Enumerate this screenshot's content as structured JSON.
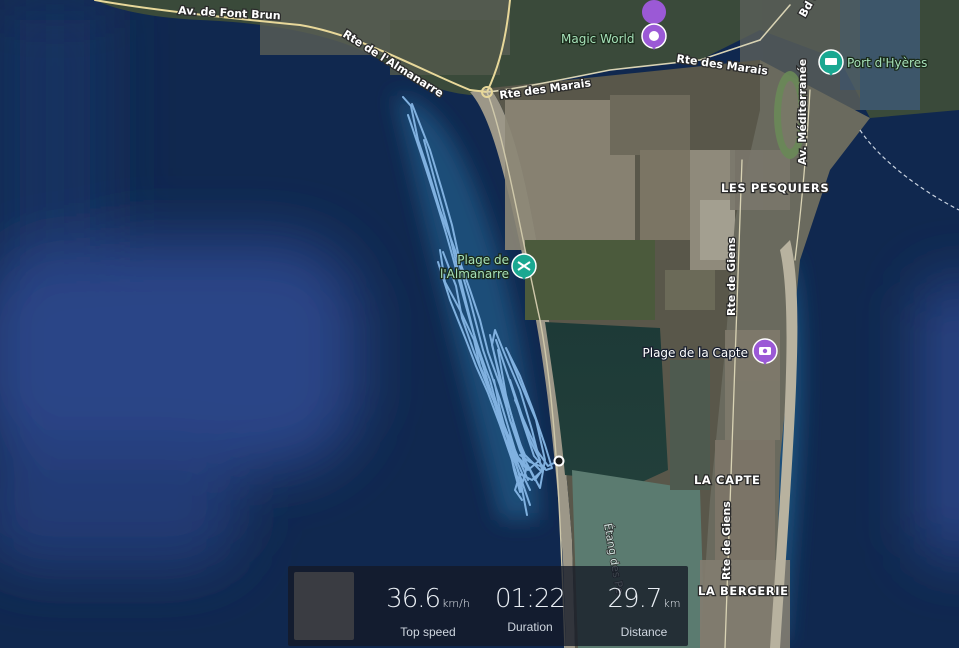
{
  "map": {
    "roads": [
      "Av. de Font Brun",
      "Rte de l'Almanarre",
      "Rte des Marais",
      "Rte des Marais",
      "Av. Méditerranée",
      "Bd de",
      "Rte de Giens",
      "Rte de Giens",
      "Étang des Pe"
    ],
    "places": [
      "LES PESQUIERS",
      "LA CAPTE",
      "LA BERGERIE"
    ],
    "pois": [
      {
        "name": "Magic World",
        "icon": "attraction-icon",
        "color": "#9b59d6"
      },
      {
        "name": "Port d'Hyères",
        "icon": "ferry-icon",
        "color": "#1aa891"
      },
      {
        "name": "Plage de\nl'Almanarre",
        "icon": "beach-icon",
        "color": "#1aa891"
      },
      {
        "name": "Plage de la Capte",
        "icon": "camera-icon",
        "color": "#9b59d6"
      }
    ],
    "track_color": "#86b7e6"
  },
  "stats": {
    "top_speed": {
      "value": "36.6",
      "unit": "km/h",
      "label": "Top speed"
    },
    "duration": {
      "value": "01:22",
      "unit": "",
      "label": "Duration"
    },
    "distance": {
      "value": "29.7",
      "unit": "km",
      "label": "Distance"
    }
  }
}
